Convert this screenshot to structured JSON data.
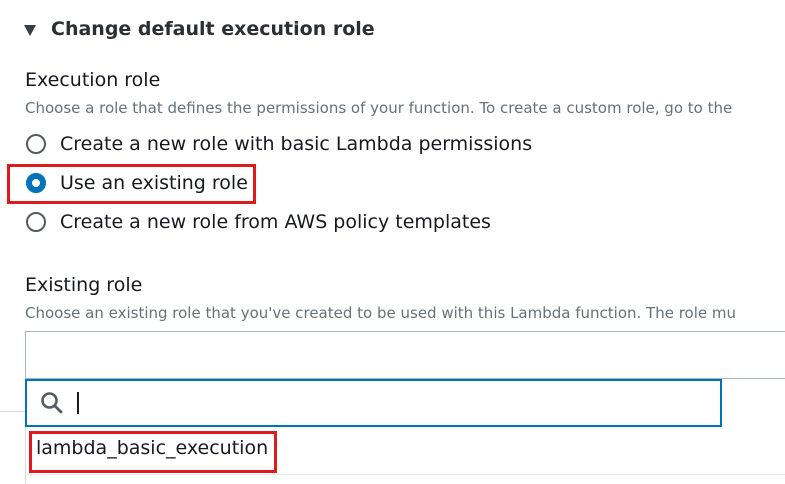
{
  "section": {
    "title": "Change default execution role"
  },
  "execution_role": {
    "label": "Execution role",
    "description": "Choose a role that defines the permissions of your function. To create a custom role, go to the",
    "options": [
      {
        "label": "Create a new role with basic Lambda permissions",
        "selected": false
      },
      {
        "label": "Use an existing role",
        "selected": true
      },
      {
        "label": "Create a new role from AWS policy templates",
        "selected": false
      }
    ]
  },
  "existing_role": {
    "label": "Existing role",
    "description": "Choose an existing role that you've created to be used with this Lambda function. The role mu",
    "select_value": "",
    "search": {
      "value": "",
      "icon": "search-icon"
    },
    "options": [
      {
        "label": "lambda_basic_execution"
      }
    ]
  },
  "colors": {
    "accent": "#0073bb",
    "highlight": "#e0191c"
  }
}
